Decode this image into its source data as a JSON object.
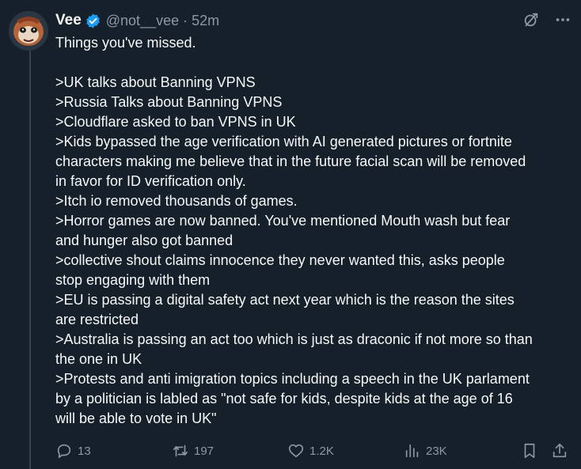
{
  "author": {
    "name": "Vee",
    "handle": "@not__vee",
    "separator": "·",
    "time": "52m"
  },
  "tweet": {
    "lines": [
      "Things you've missed.",
      "",
      ">UK talks about Banning VPNS",
      ">Russia Talks about Banning VPNS",
      ">Cloudflare asked to ban VPNS in UK",
      ">Kids bypassed the age verification with AI generated pictures or fortnite",
      "characters making me believe that in the future facial scan will be removed",
      "in favor for ID verification only.",
      ">Itch io removed thousands of games.",
      ">Horror games are now banned. You've mentioned Mouth wash but fear",
      "and hunger also got banned",
      ">collective shout claims innocence they never wanted this, asks people",
      "stop engaging with them",
      ">EU is passing a digital safety act next year which is the reason the sites",
      "are restricted",
      ">Australia is passing an act too which is just as draconic if not more so than",
      "the one in UK",
      ">Protests and anti imigration topics including a speech in the UK parlament",
      "by a politician is labled as \"not safe for kids, despite kids at the age of 16",
      "will be able to vote in UK\""
    ]
  },
  "actions": {
    "replies": "13",
    "reposts": "197",
    "likes": "1.2K",
    "views": "23K"
  },
  "icons": {
    "avatar": "avatar-icon",
    "verified": "verified-badge-icon",
    "grok": "grok-icon",
    "more": "more-icon",
    "reply": "reply-icon",
    "repost": "repost-icon",
    "like": "heart-icon",
    "views": "views-icon",
    "bookmark": "bookmark-icon",
    "share": "share-icon"
  },
  "colors": {
    "background": "#15202b",
    "text": "#f7f9f9",
    "secondary_text": "#8b98a5",
    "verified": "#1d9bf0",
    "thread_line": "#38444d"
  }
}
